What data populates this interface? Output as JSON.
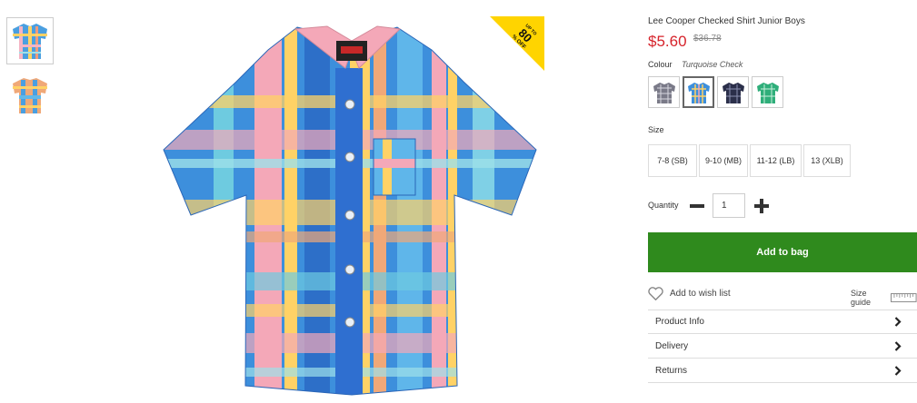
{
  "gallery": {
    "thumbnails": [
      {
        "name": "front-view-thumbnail",
        "selected": true
      },
      {
        "name": "back-view-thumbnail",
        "selected": false
      }
    ]
  },
  "badge": {
    "prefix": "UP TO",
    "amount": "80",
    "suffix": "% OFF",
    "color": "#ffd400"
  },
  "product": {
    "title": "Lee Cooper Checked Shirt Junior Boys",
    "price": "$5.60",
    "old_price": "$36.78",
    "price_color": "#d6232b"
  },
  "colour": {
    "label": "Colour",
    "selected": "Turquoise Check",
    "swatches": [
      {
        "name": "grey-check",
        "selected": false
      },
      {
        "name": "turquoise-check",
        "selected": true
      },
      {
        "name": "navy-check",
        "selected": false
      },
      {
        "name": "green-check",
        "selected": false
      }
    ]
  },
  "size": {
    "label": "Size",
    "options": [
      "7-8 (SB)",
      "9-10 (MB)",
      "11-12 (LB)",
      "13 (XLB)"
    ]
  },
  "quantity": {
    "label": "Quantity",
    "value": "1"
  },
  "actions": {
    "add_to_bag": "Add to bag",
    "add_to_bag_color": "#2f8a1d",
    "wishlist": "Add to wish list",
    "size_guide": "Size guide"
  },
  "accordion": [
    "Product Info",
    "Delivery",
    "Returns"
  ]
}
